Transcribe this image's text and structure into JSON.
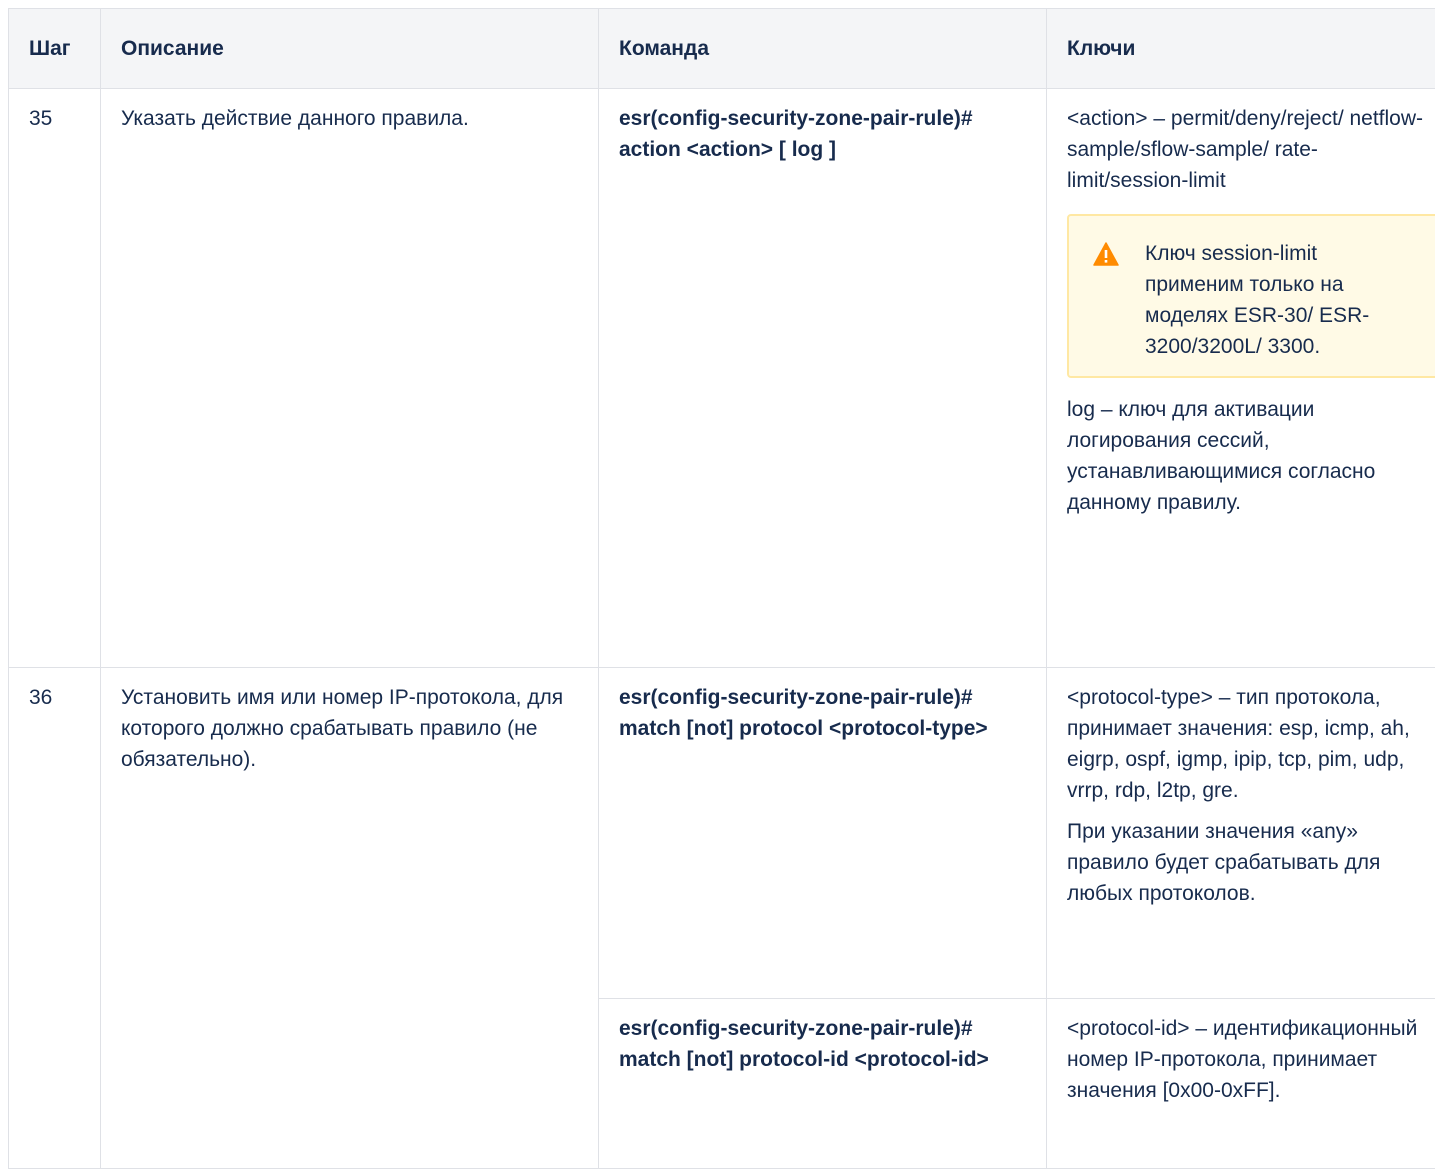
{
  "table": {
    "headers": {
      "step": "Шаг",
      "description": "Описание",
      "command": "Команда",
      "keys": "Ключи"
    },
    "rows": [
      {
        "step": "35",
        "description": "Указать действие данного правила.",
        "command": "esr(config-security-zone-pair-rule)# action <action> [ log ]",
        "keys_before": "<action> – permit/deny/reject/ netflow-sample/sflow-sample/ rate-limit/session-limit",
        "warning": "Ключ session-limit применим только на моделях ESR-30/ ESR-3200/3200L/ 3300.",
        "keys_after": "log – ключ для активации логирования сессий, устанавливающимися согласно данному правилу."
      },
      {
        "step": "36",
        "description": "Установить имя или номер IP-протокола, для которого должно срабатывать правило (не обязательно).",
        "commands": [
          {
            "command": "esr(config-security-zone-pair-rule)# match [not] protocol <protocol-type>",
            "keys": [
              "<protocol-type> – тип протокола, принимает значения: esp, icmp, ah, eigrp, ospf, igmp, ipip, tcp, pim, udp, vrrp, rdp, l2tp, gre.",
              "При указании значения «any» правило будет срабатывать для любых протоколов."
            ]
          },
          {
            "command": "esr(config-security-zone-pair-rule)# match [not] protocol-id <protocol-id>",
            "keys": [
              "<protocol-id> – идентификационный номер IP-протокола, принимает значения [0x00-0xFF]."
            ]
          }
        ]
      }
    ]
  },
  "colors": {
    "header_bg": "#f4f5f7",
    "border": "#dfe1e6",
    "warning_bg": "#fffae6",
    "warning_border": "#ffe8a3",
    "warning_icon": "#ff8b00"
  },
  "icons": {
    "warning": "warning-icon"
  }
}
